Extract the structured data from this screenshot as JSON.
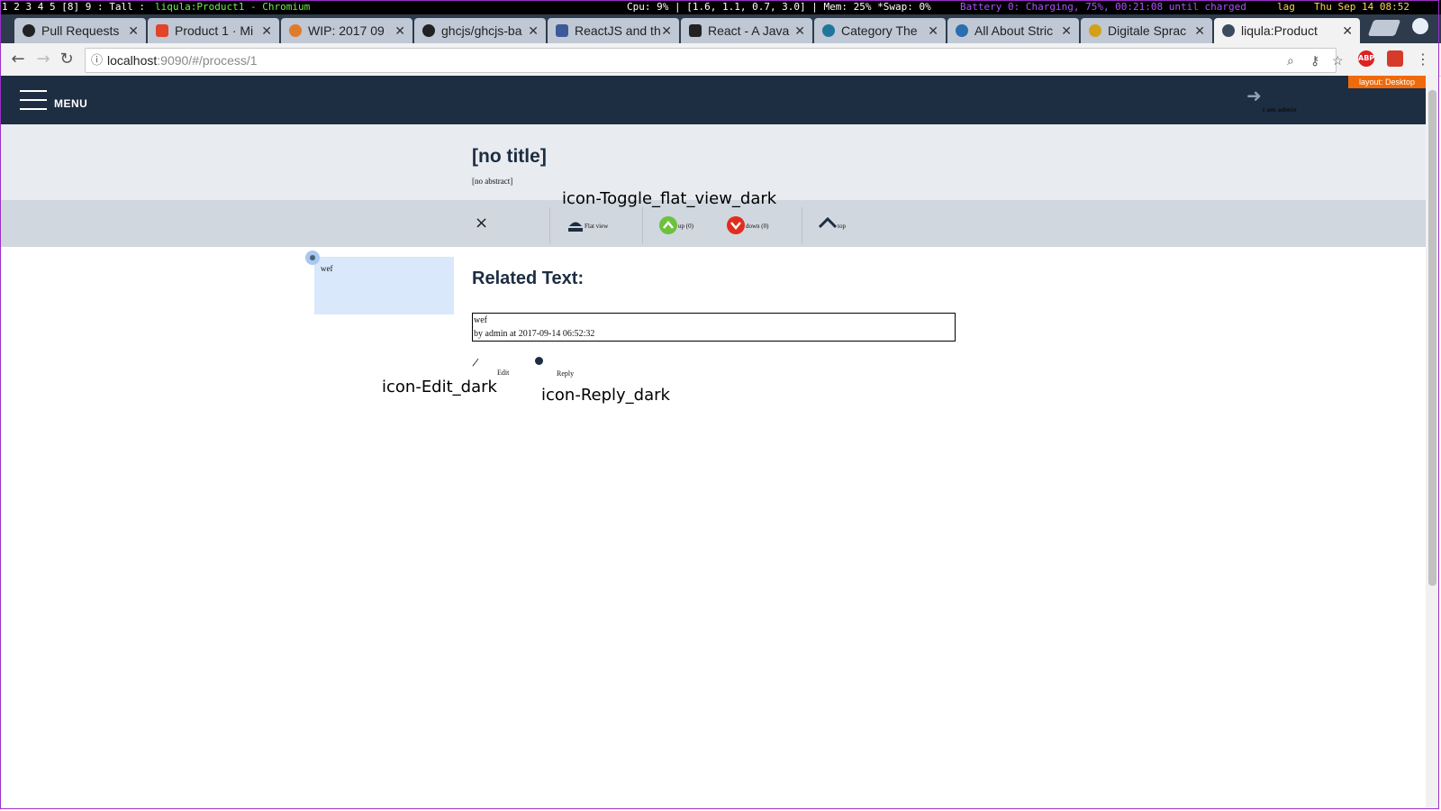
{
  "status_bar": {
    "workspaces": "1 2 3 4 5 [8] 9 : Tall :",
    "window_title": "liqula:Product1 - Chromium",
    "system": "Cpu: 9% | [1.6, 1.1, 0.7, 3.0] | Mem: 25% *Swap: 0%",
    "battery": "Battery 0: Charging, 75%, 00:21:08 until charged",
    "lag": "lag",
    "datetime": "Thu Sep 14 08:52"
  },
  "tabs": [
    {
      "label": "Pull Requests",
      "color": "#222222"
    },
    {
      "label": "Product 1 · Mi",
      "color": "#e2432a"
    },
    {
      "label": "WIP: 2017 09",
      "color": "#e07b2a"
    },
    {
      "label": "ghcjs/ghcjs-ba",
      "color": "#222222"
    },
    {
      "label": "ReactJS and th",
      "color": "#3d5a98"
    },
    {
      "label": "React - A Java",
      "color": "#222222"
    },
    {
      "label": "Category The",
      "color": "#21759b"
    },
    {
      "label": "All About Stric",
      "color": "#2a6db0"
    },
    {
      "label": "Digitale Sprac",
      "color": "#d4a017"
    },
    {
      "label": "liqula:Product",
      "color": "#3b4a5e"
    }
  ],
  "address_bar": {
    "host": "localhost",
    "path": ":9090/#/process/1"
  },
  "extensions": {
    "abp": "ABP"
  },
  "header": {
    "menu_label": "MENU",
    "login_label": "I am admin",
    "layout_badge": "layout: Desktop"
  },
  "process": {
    "title": "[no title]",
    "abstract": "[no abstract]"
  },
  "actions": {
    "close": "×",
    "flat_view_label": "Flat view",
    "flat_view_annotation": "icon-Toggle_flat_view_dark",
    "up_label": "up (0)",
    "down_label": "down (0)",
    "top_label": "top"
  },
  "side_item": {
    "text": "wef"
  },
  "related": {
    "heading": "Related Text:",
    "text": "wef",
    "meta": "by admin at 2017-09-14 06:52:32"
  },
  "comment_actions": {
    "edit_label": "Edit",
    "edit_annotation": "icon-Edit_dark",
    "reply_label": "Reply",
    "reply_annotation": "icon-Reply_dark"
  },
  "colors": {
    "header_bg": "#1d2d42",
    "vote_up": "#6bc23c",
    "vote_down": "#e02d1f",
    "badge": "#f06a0a"
  }
}
